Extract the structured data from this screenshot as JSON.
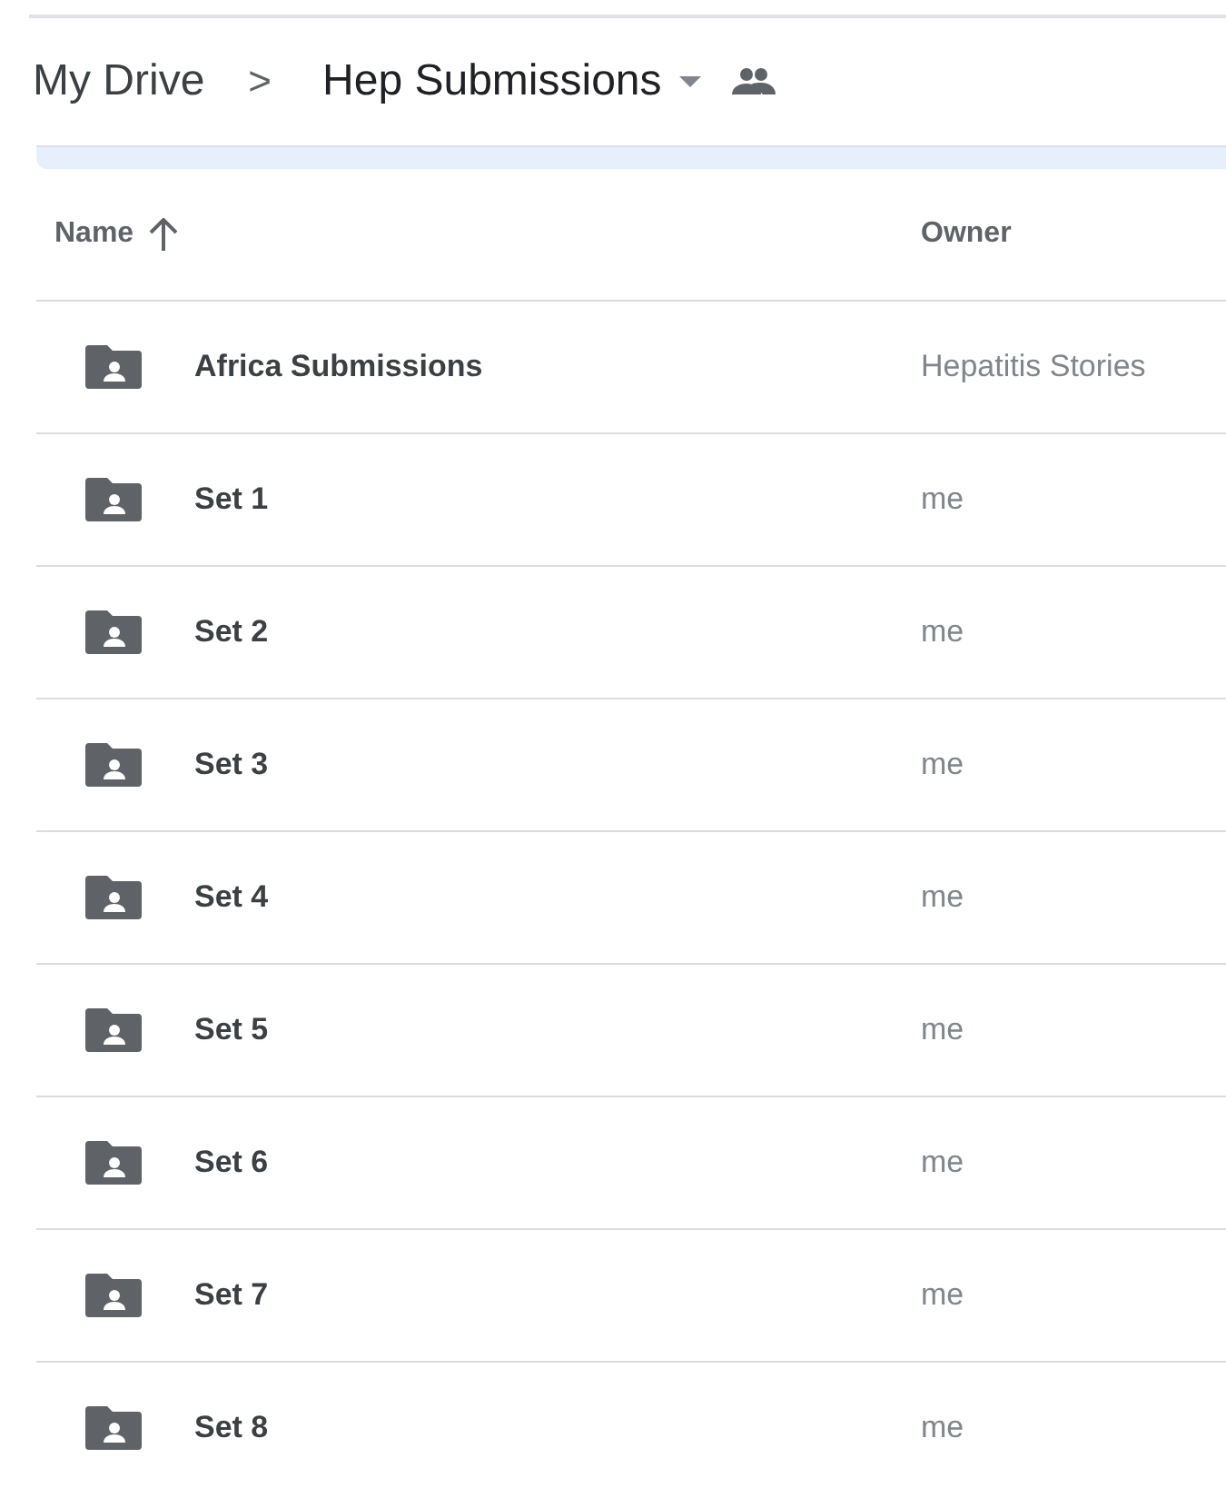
{
  "breadcrumb": {
    "root": "My Drive",
    "separator": ">",
    "current": "Hep Submissions"
  },
  "table": {
    "columns": [
      {
        "label": "Name",
        "sorted": true
      },
      {
        "label": "Owner",
        "sorted": false
      }
    ],
    "rows": [
      {
        "name": "Africa Submissions",
        "owner": "Hepatitis Stories"
      },
      {
        "name": "Set 1",
        "owner": "me"
      },
      {
        "name": "Set 2",
        "owner": "me"
      },
      {
        "name": "Set 3",
        "owner": "me"
      },
      {
        "name": "Set 4",
        "owner": "me"
      },
      {
        "name": "Set 5",
        "owner": "me"
      },
      {
        "name": "Set 6",
        "owner": "me"
      },
      {
        "name": "Set 7",
        "owner": "me"
      },
      {
        "name": "Set 8",
        "owner": "me"
      }
    ]
  }
}
